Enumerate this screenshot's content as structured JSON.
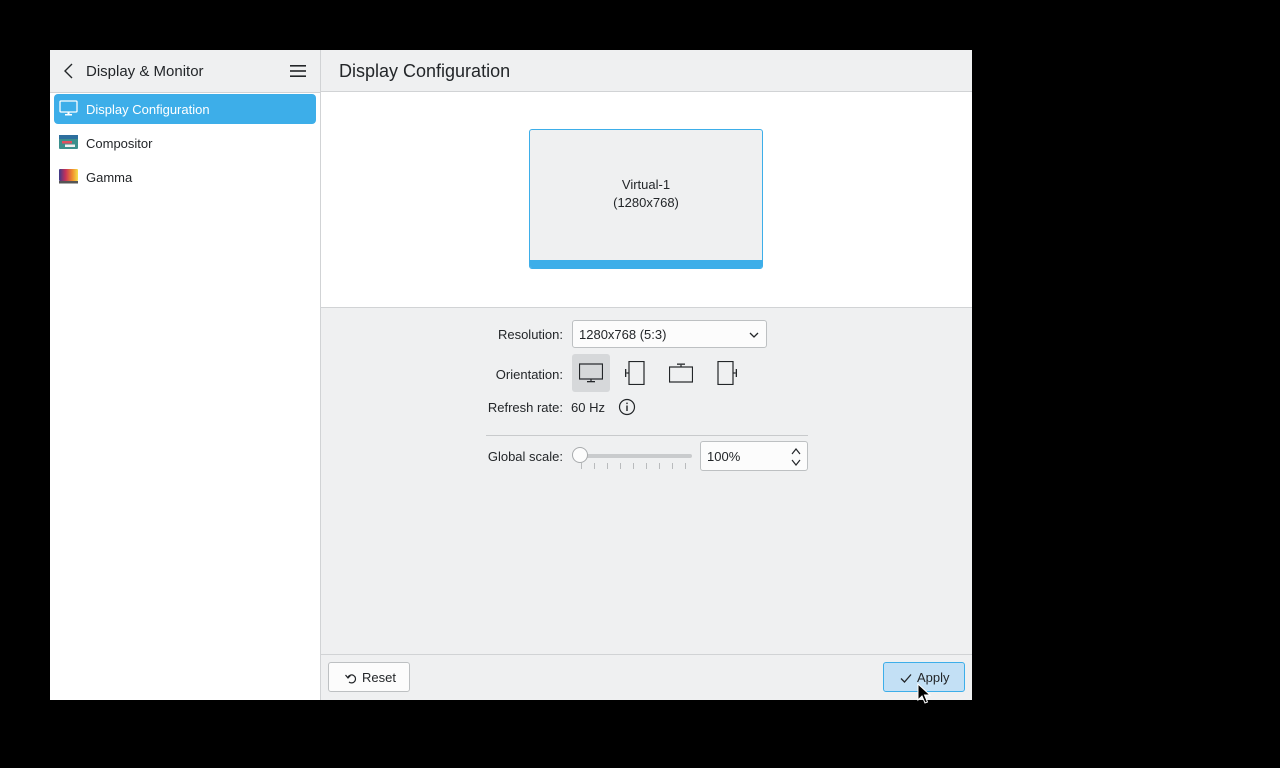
{
  "sidebar": {
    "title": "Display & Monitor",
    "items": [
      {
        "label": "Display Configuration",
        "active": true,
        "icon": "display-config-icon"
      },
      {
        "label": "Compositor",
        "active": false,
        "icon": "compositor-icon"
      },
      {
        "label": "Gamma",
        "active": false,
        "icon": "gamma-icon"
      }
    ]
  },
  "main": {
    "title": "Display Configuration",
    "monitor": {
      "name": "Virtual-1",
      "resolution": "(1280x768)"
    },
    "form": {
      "resolution_label": "Resolution:",
      "resolution_value": "1280x768 (5:3)",
      "orientation_label": "Orientation:",
      "orientation_options": [
        "landscape",
        "portrait-left",
        "landscape-flipped",
        "portrait-right"
      ],
      "orientation_selected": "landscape",
      "refresh_label": "Refresh rate:",
      "refresh_value": "60 Hz",
      "scale_label": "Global scale:",
      "scale_value": "100%",
      "scale_slider_fraction": 0.0
    }
  },
  "footer": {
    "reset_label": "Reset",
    "apply_label": "Apply"
  },
  "colors": {
    "accent": "#3daee9",
    "window_bg": "#eff0f1",
    "panel_bg": "#ffffff",
    "text": "#232629"
  }
}
